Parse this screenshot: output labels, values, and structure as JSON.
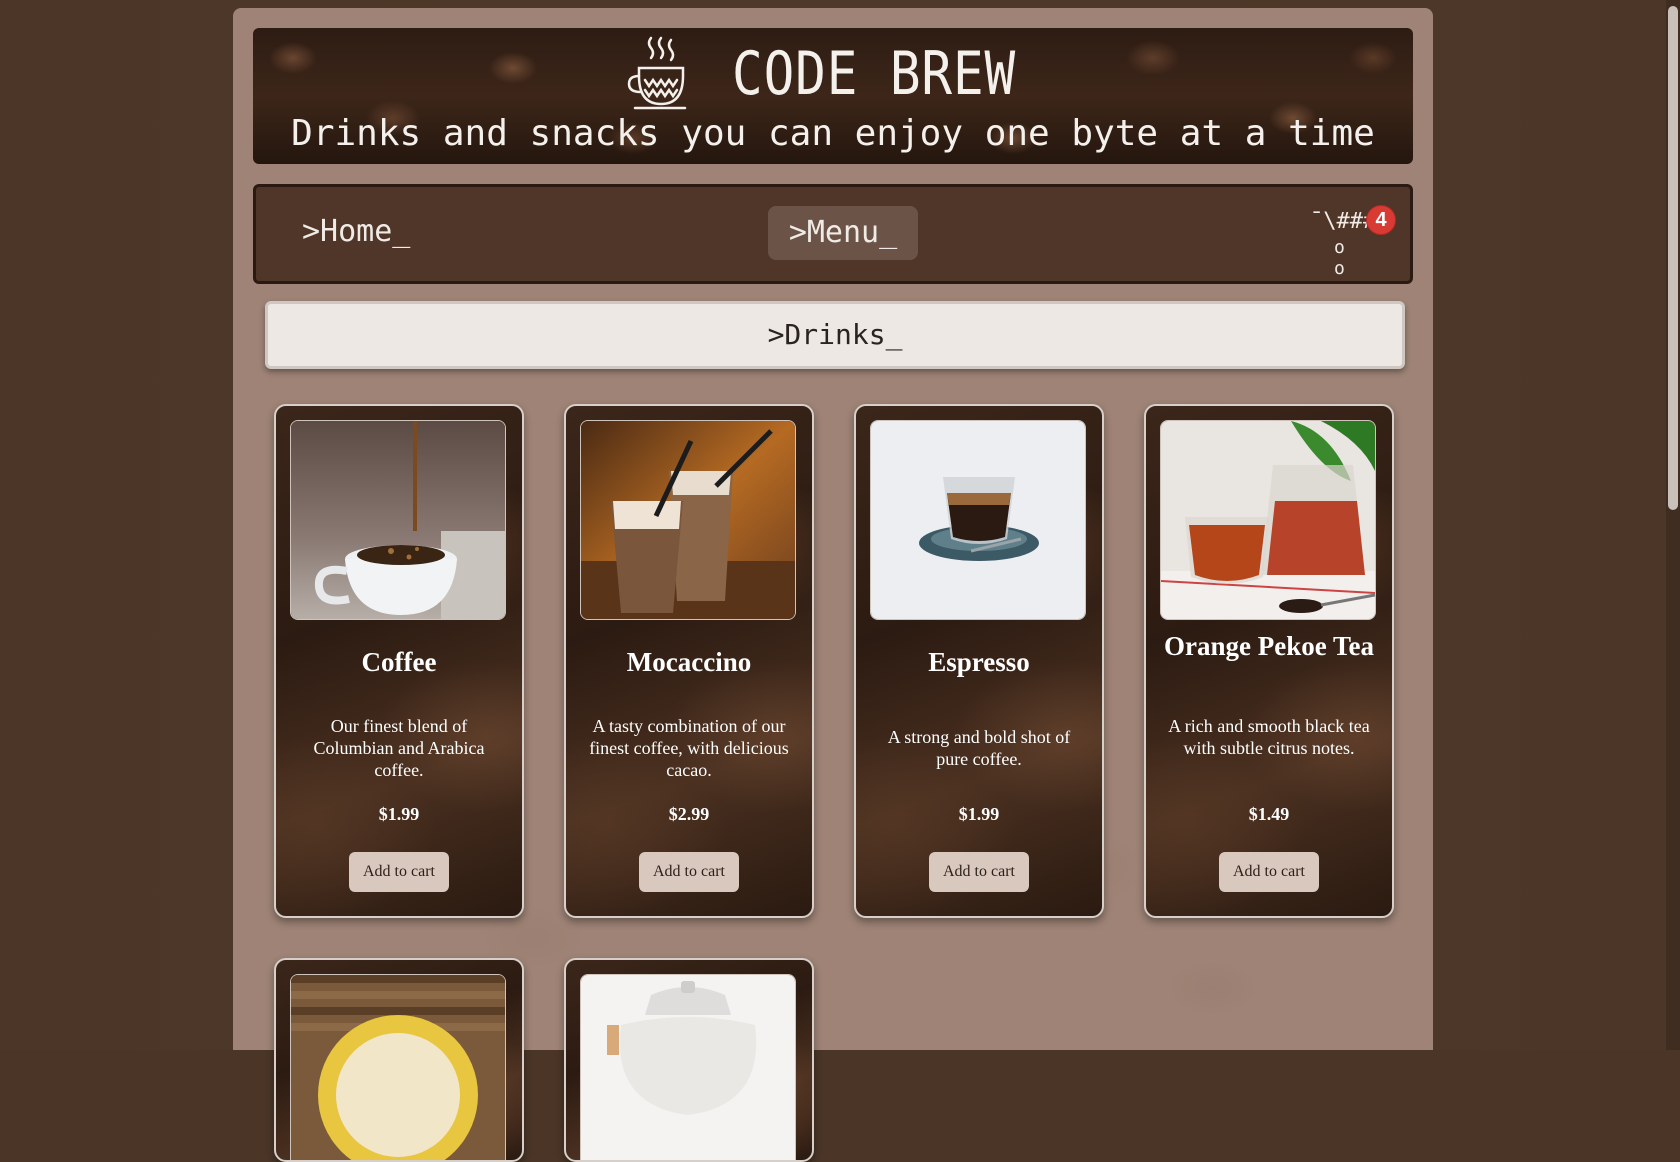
{
  "banner": {
    "title": "CODE BREW",
    "subtitle": "Drinks and snacks you can enjoy one byte at a time",
    "icon": "steaming-cup-icon"
  },
  "nav": {
    "home_label": ">Home_",
    "menu_label": ">Menu_",
    "cart_glyph": "¯\\###/",
    "cart_wheels": "o o",
    "cart_count": "4"
  },
  "section": {
    "title": ">Drinks_"
  },
  "products": [
    {
      "name": "Coffee",
      "description": "Our finest blend of Columbian and Arabica coffee.",
      "price": "$1.99",
      "button": "Add to cart",
      "image": "coffee-pour-cup-photo"
    },
    {
      "name": "Mocaccino",
      "description": "A tasty combination of our finest coffee, with delicious cacao.",
      "price": "$2.99",
      "button": "Add to cart",
      "image": "mocaccino-glasses-photo"
    },
    {
      "name": "Espresso",
      "description": "A strong and bold shot of pure coffee.",
      "price": "$1.99",
      "button": "Add to cart",
      "image": "espresso-glass-saucer-photo"
    },
    {
      "name": "Orange Pekoe Tea",
      "description": "A rich and smooth black tea with subtle citrus notes.",
      "price": "$1.49",
      "button": "Add to cart",
      "image": "tea-cup-teapot-photo"
    }
  ],
  "partial_products": [
    {
      "image": "latte-art-cup-photo"
    },
    {
      "image": "glass-teapot-photo"
    }
  ],
  "colors": {
    "page_bg": "#4b3627",
    "panel_bg": "#9e8376",
    "nav_bg": "#4f3628",
    "badge": "#d83a34",
    "button_bg": "#d8c8bd"
  }
}
